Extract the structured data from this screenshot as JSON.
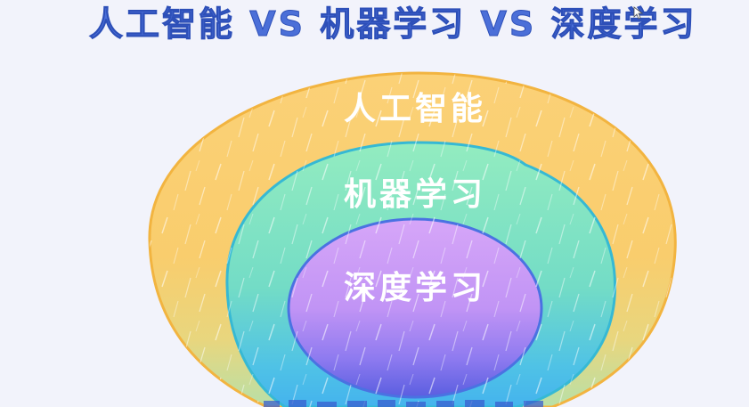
{
  "title": "人工智能 VS 机器学习 VS 深度学习",
  "regions": {
    "outer": {
      "label": "人工智能",
      "color": "#f9cf72"
    },
    "middle": {
      "label": "机器学习",
      "color": "#7fe0c2"
    },
    "inner": {
      "label": "深度学习",
      "color": "#c99af5"
    }
  },
  "colors": {
    "title": "#4b6fd8",
    "background": "#f2f3fb",
    "outline_outer": "#f2b440",
    "outline_middle": "#36b9d4",
    "outline_inner": "#4a72e2"
  },
  "icons": {
    "cursor": "cursor-arrow-icon"
  }
}
